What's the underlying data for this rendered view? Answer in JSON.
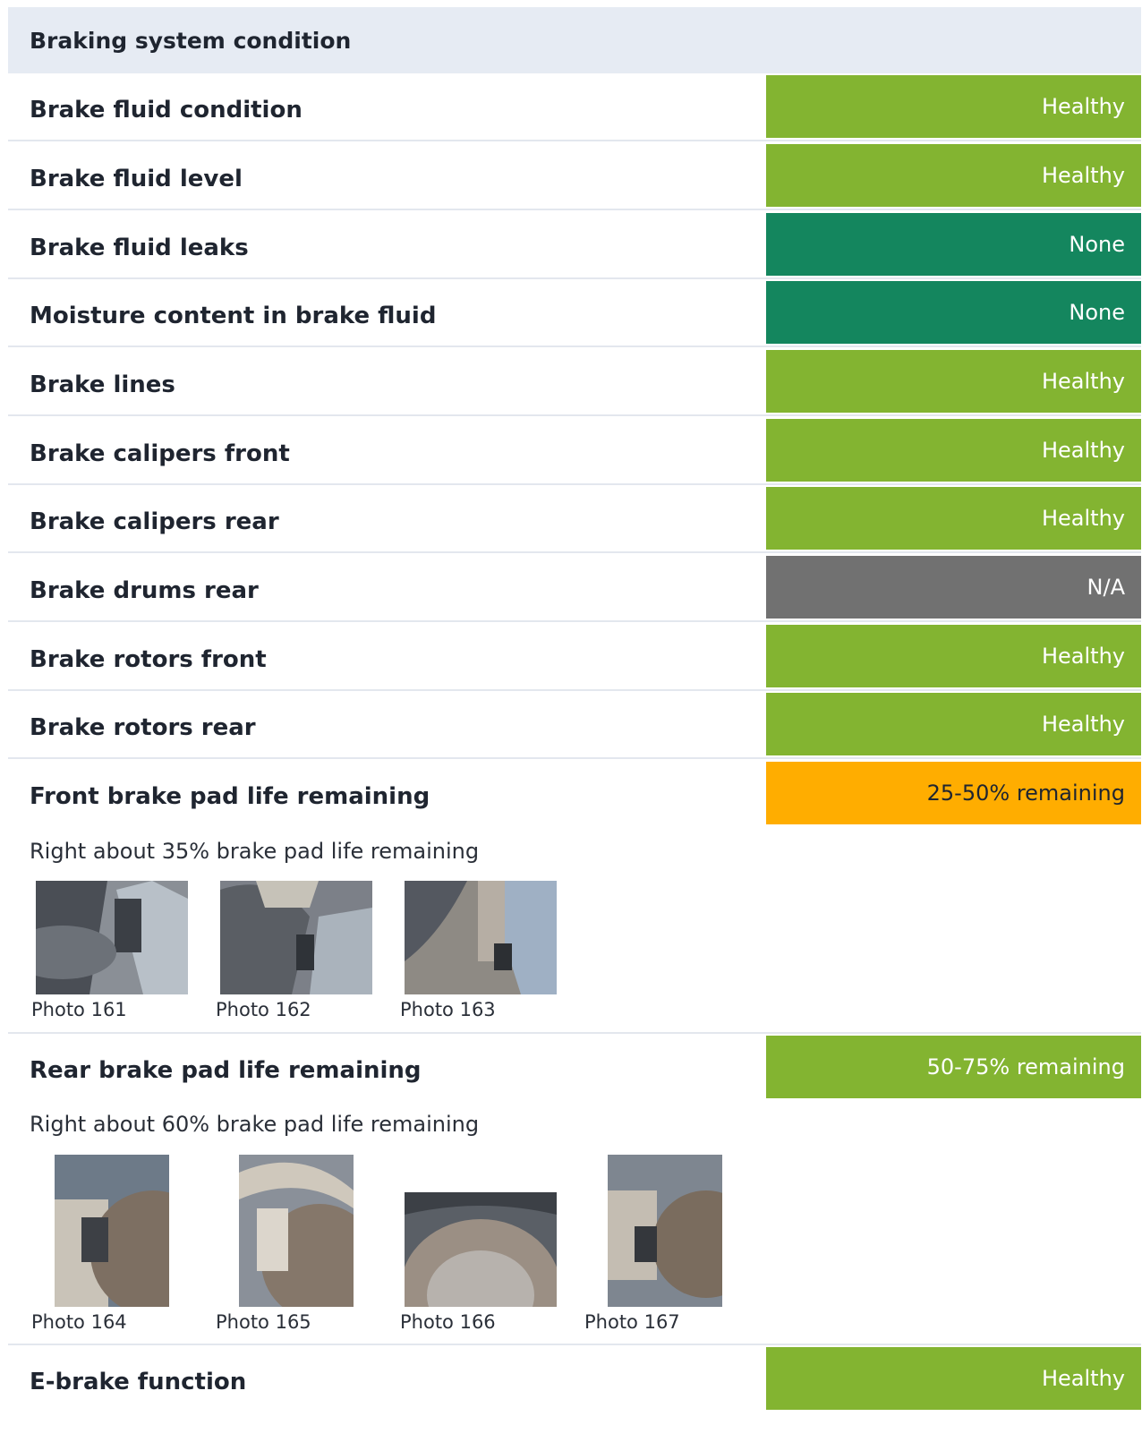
{
  "section_title": "Braking system condition",
  "colors": {
    "healthy": "#83b431",
    "none": "#14865e",
    "na": "#717171",
    "warning": "#ffad00",
    "header_bg": "#e6ebf3"
  },
  "rows": [
    {
      "label": "Brake fluid condition",
      "status": "Healthy",
      "status_type": "healthy"
    },
    {
      "label": "Brake fluid level",
      "status": "Healthy",
      "status_type": "healthy"
    },
    {
      "label": "Brake fluid leaks",
      "status": "None",
      "status_type": "none"
    },
    {
      "label": "Moisture content in brake fluid",
      "status": "None",
      "status_type": "none"
    },
    {
      "label": "Brake lines",
      "status": "Healthy",
      "status_type": "healthy"
    },
    {
      "label": "Brake calipers front",
      "status": "Healthy",
      "status_type": "healthy"
    },
    {
      "label": "Brake calipers rear",
      "status": "Healthy",
      "status_type": "healthy"
    },
    {
      "label": "Brake drums rear",
      "status": "N/A",
      "status_type": "na"
    },
    {
      "label": "Brake rotors front",
      "status": "Healthy",
      "status_type": "healthy"
    },
    {
      "label": "Brake rotors rear",
      "status": "Healthy",
      "status_type": "healthy"
    }
  ],
  "front_pads": {
    "label": "Front brake pad life remaining",
    "status": "25-50% remaining",
    "status_type": "warning",
    "note": "Right about 35% brake pad life remaining",
    "photos": [
      "Photo 161",
      "Photo 162",
      "Photo 163"
    ]
  },
  "rear_pads": {
    "label": "Rear brake pad life remaining",
    "status": "50-75% remaining",
    "status_type": "healthy",
    "note": "Right about 60% brake pad life remaining",
    "photos": [
      "Photo 164",
      "Photo 165",
      "Photo 166",
      "Photo 167"
    ]
  },
  "ebrake": {
    "label": "E-brake function",
    "status": "Healthy",
    "status_type": "healthy"
  }
}
